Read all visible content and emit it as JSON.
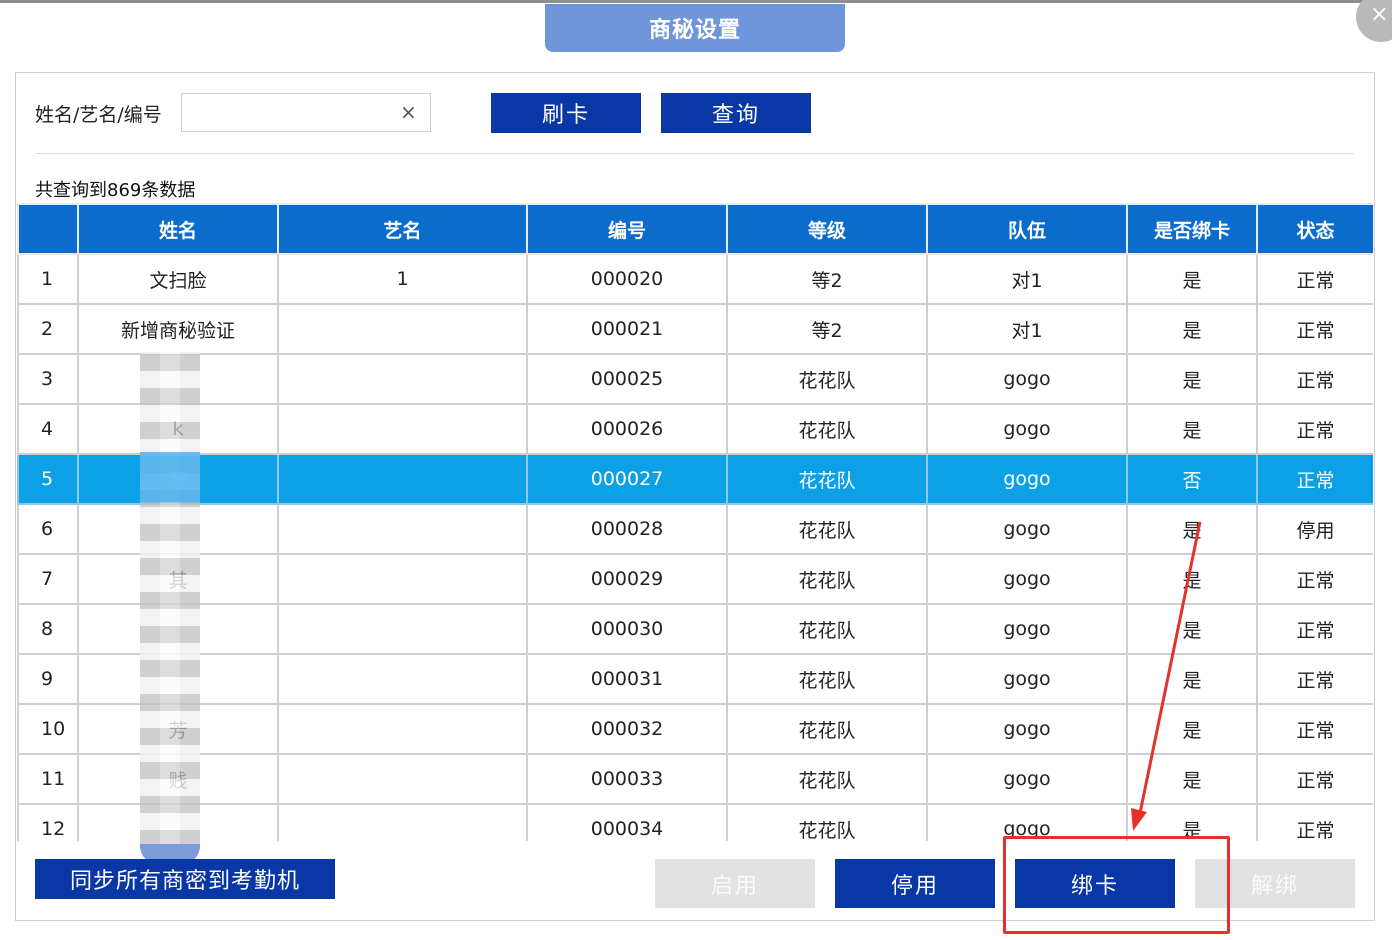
{
  "dialog": {
    "title": "商秘设置",
    "close_glyph": "×"
  },
  "search": {
    "label": "姓名/艺名/编号",
    "value": "",
    "placeholder": "",
    "clear_glyph": "×"
  },
  "buttons": {
    "swipe": "刷卡",
    "query": "查询"
  },
  "result_count": "共查询到869条数据",
  "table": {
    "columns": [
      "",
      "姓名",
      "艺名",
      "编号",
      "等级",
      "队伍",
      "是否绑卡",
      "状态"
    ],
    "rows": [
      [
        "1",
        "文扫脸",
        "1",
        "000020",
        "等2",
        "对1",
        "是",
        "正常"
      ],
      [
        "2",
        "新增商秘验证",
        "",
        "000021",
        "等2",
        "对1",
        "是",
        "正常"
      ],
      [
        "3",
        "",
        "",
        "000025",
        "花花队",
        "gogo",
        "是",
        "正常"
      ],
      [
        "4",
        "k",
        "",
        "000026",
        "花花队",
        "gogo",
        "是",
        "正常"
      ],
      [
        "5",
        "琴",
        "",
        "000027",
        "花花队",
        "gogo",
        "否",
        "正常"
      ],
      [
        "6",
        "",
        "",
        "000028",
        "花花队",
        "gogo",
        "是",
        "停用"
      ],
      [
        "7",
        "其",
        "",
        "000029",
        "花花队",
        "gogo",
        "是",
        "正常"
      ],
      [
        "8",
        "",
        "",
        "000030",
        "花花队",
        "gogo",
        "是",
        "正常"
      ],
      [
        "9",
        "",
        "",
        "000031",
        "花花队",
        "gogo",
        "是",
        "正常"
      ],
      [
        "10",
        "芳",
        "",
        "000032",
        "花花队",
        "gogo",
        "是",
        "正常"
      ],
      [
        "11",
        "贱",
        "",
        "000033",
        "花花队",
        "gogo",
        "是",
        "正常"
      ],
      [
        "12",
        "",
        "",
        "000034",
        "花花队",
        "gogo",
        "是",
        "正常"
      ]
    ],
    "selected_row": 4
  },
  "footer": {
    "sync": "同步所有商密到考勤机",
    "enable": "启用",
    "disable": "停用",
    "bind": "绑卡",
    "unbind": "解绑"
  },
  "colors": {
    "primary": "#0a37a6",
    "header": "#0c6ccb",
    "selected": "#0ca0e6",
    "title_tab": "#6f95db",
    "annotation": "#e5312a"
  }
}
